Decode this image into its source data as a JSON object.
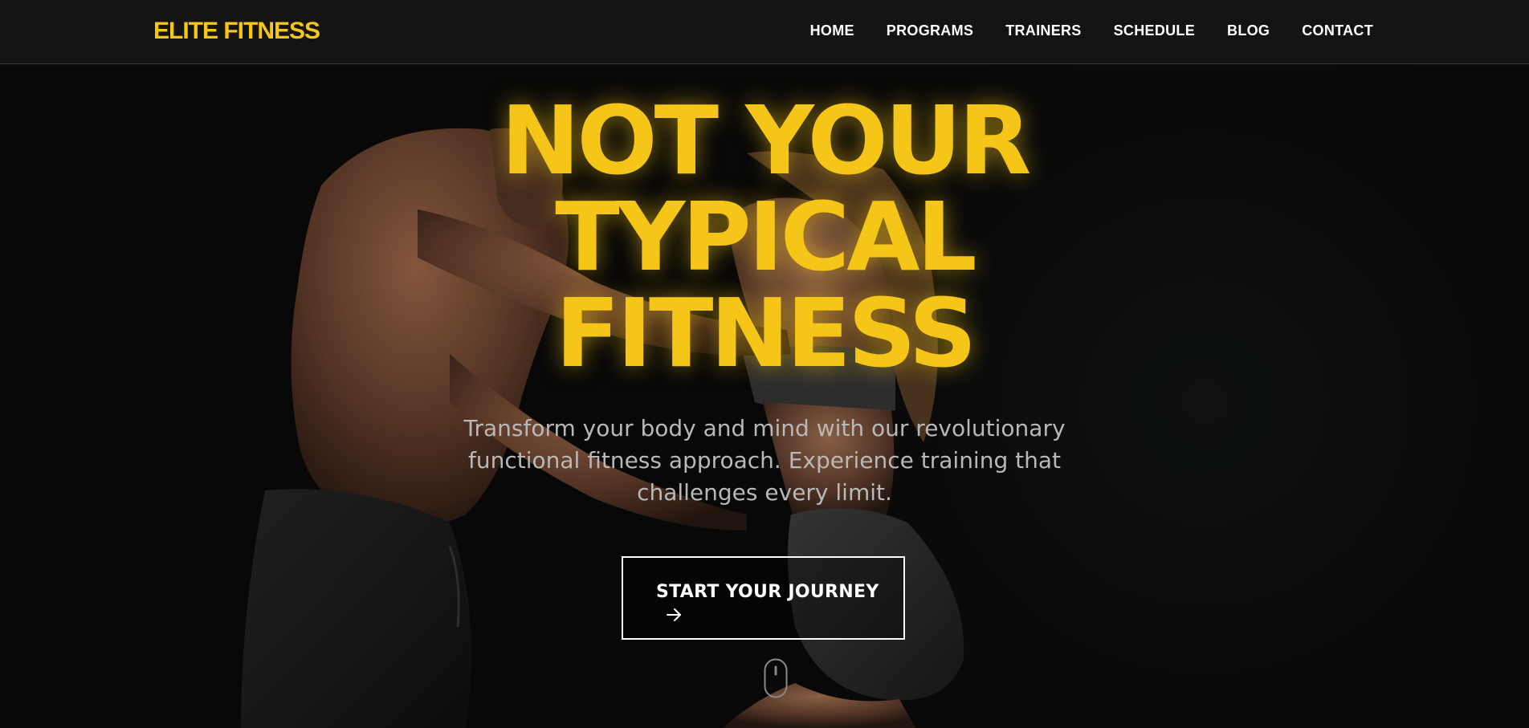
{
  "navbar": {
    "logo": "ELITE FITNESS",
    "links": [
      "HOME",
      "PROGRAMS",
      "TRAINERS",
      "SCHEDULE",
      "BLOG",
      "CONTACT"
    ]
  },
  "hero": {
    "headline": [
      "NOT YOUR",
      "TYPICAL",
      "FITNESS"
    ],
    "subtitle": "Transform your body and mind with our revolutionary functional fitness approach. Experience training that challenges every limit.",
    "cta_label": "START YOUR JOURNEY",
    "cta_icon": "arrow-right-icon",
    "scroll_icon": "mouse-scroll-icon",
    "background_image": "man-and-woman-training-photo"
  },
  "colors": {
    "accent": "#f5c518",
    "nav_bg": "#141414",
    "text": "#ffffff",
    "subtitle": "#b8b8b8"
  }
}
